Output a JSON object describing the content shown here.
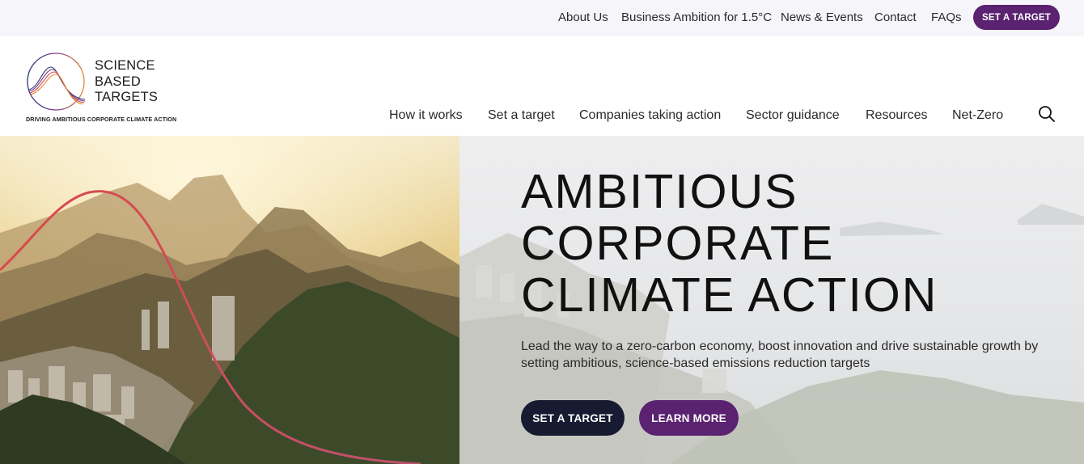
{
  "topbar": {
    "links": [
      "About Us",
      "Business Ambition for 1.5°C",
      "News & Events",
      "Contact",
      "FAQs"
    ],
    "cta_label": "SET A TARGET"
  },
  "logo": {
    "lines": [
      "SCIENCE",
      "BASED",
      "TARGETS"
    ],
    "tagline": "DRIVING AMBITIOUS CORPORATE CLIMATE ACTION"
  },
  "nav": {
    "items": [
      "How it works",
      "Set a target",
      "Companies taking action",
      "Sector guidance",
      "Resources",
      "Net-Zero"
    ],
    "search_icon": "search-icon"
  },
  "hero": {
    "title_lines": [
      "AMBITIOUS",
      "CORPORATE",
      "CLIMATE ACTION"
    ],
    "subtitle": "Lead the way to a zero-carbon economy, boost innovation and drive sustainable growth by setting ambitious, science-based emissions reduction targets",
    "primary_button": "SET A TARGET",
    "secondary_button": "LEARN MORE"
  },
  "colors": {
    "brand_purple": "#5a2270",
    "dark_navy": "#171b31",
    "accent_curve": "#d84a4f"
  }
}
